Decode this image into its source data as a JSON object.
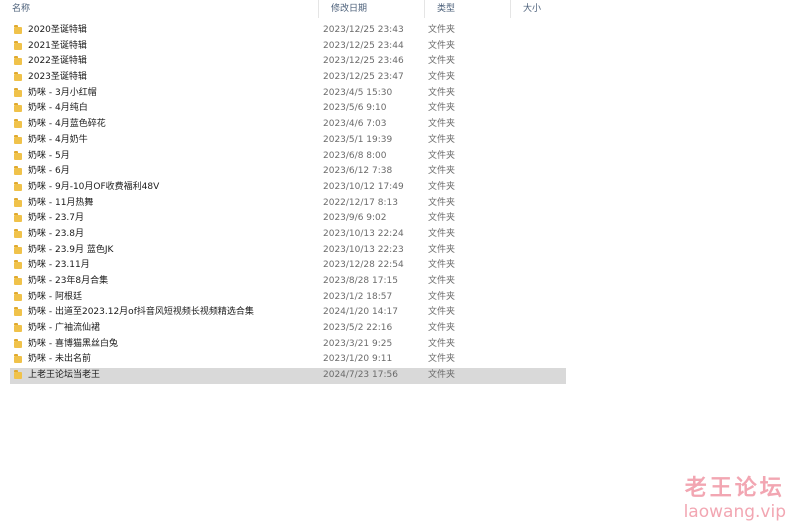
{
  "columns": {
    "name": "名称",
    "date": "修改日期",
    "type": "类型",
    "size": "大小"
  },
  "sort_indicator": "^",
  "rows": [
    {
      "name": "2020圣诞特辑",
      "date": "2023/12/25 23:43",
      "type": "文件夹"
    },
    {
      "name": "2021圣诞特辑",
      "date": "2023/12/25 23:44",
      "type": "文件夹"
    },
    {
      "name": "2022圣诞特辑",
      "date": "2023/12/25 23:46",
      "type": "文件夹"
    },
    {
      "name": "2023圣诞特辑",
      "date": "2023/12/25 23:47",
      "type": "文件夹"
    },
    {
      "name": "奶咪 - 3月小红帽",
      "date": "2023/4/5 15:30",
      "type": "文件夹"
    },
    {
      "name": "奶咪 - 4月纯白",
      "date": "2023/5/6 9:10",
      "type": "文件夹"
    },
    {
      "name": "奶咪 - 4月蓝色碎花",
      "date": "2023/4/6 7:03",
      "type": "文件夹"
    },
    {
      "name": "奶咪 - 4月奶牛",
      "date": "2023/5/1 19:39",
      "type": "文件夹"
    },
    {
      "name": "奶咪 - 5月",
      "date": "2023/6/8 8:00",
      "type": "文件夹"
    },
    {
      "name": "奶咪 - 6月",
      "date": "2023/6/12 7:38",
      "type": "文件夹"
    },
    {
      "name": "奶咪 - 9月-10月OF收费福利48V",
      "date": "2023/10/12 17:49",
      "type": "文件夹"
    },
    {
      "name": "奶咪 - 11月热舞",
      "date": "2022/12/17 8:13",
      "type": "文件夹"
    },
    {
      "name": "奶咪 - 23.7月",
      "date": "2023/9/6 9:02",
      "type": "文件夹"
    },
    {
      "name": "奶咪 - 23.8月",
      "date": "2023/10/13 22:24",
      "type": "文件夹"
    },
    {
      "name": "奶咪 - 23.9月  蓝色JK",
      "date": "2023/10/13 22:23",
      "type": "文件夹"
    },
    {
      "name": "奶咪 - 23.11月",
      "date": "2023/12/28 22:54",
      "type": "文件夹"
    },
    {
      "name": "奶咪 - 23年8月合集",
      "date": "2023/8/28 17:15",
      "type": "文件夹"
    },
    {
      "name": "奶咪 - 阿根廷",
      "date": "2023/1/2 18:57",
      "type": "文件夹"
    },
    {
      "name": "奶咪 - 出道至2023.12月of抖音风短视频长视频精选合集",
      "date": "2024/1/20 14:17",
      "type": "文件夹"
    },
    {
      "name": "奶咪 - 广袖流仙裙",
      "date": "2023/5/2 22:16",
      "type": "文件夹"
    },
    {
      "name": "奶咪 - 喜博猫黑丝白兔",
      "date": "2023/3/21 9:25",
      "type": "文件夹"
    },
    {
      "name": "奶咪 - 未出名前",
      "date": "2023/1/20 9:11",
      "type": "文件夹"
    },
    {
      "name": "上老王论坛当老王",
      "date": "2024/7/23 17:56",
      "type": "文件夹"
    }
  ],
  "selected_index": 22,
  "icon": "folder-icon",
  "watermark": {
    "title": "老王论坛",
    "url": "laowang.vip"
  }
}
